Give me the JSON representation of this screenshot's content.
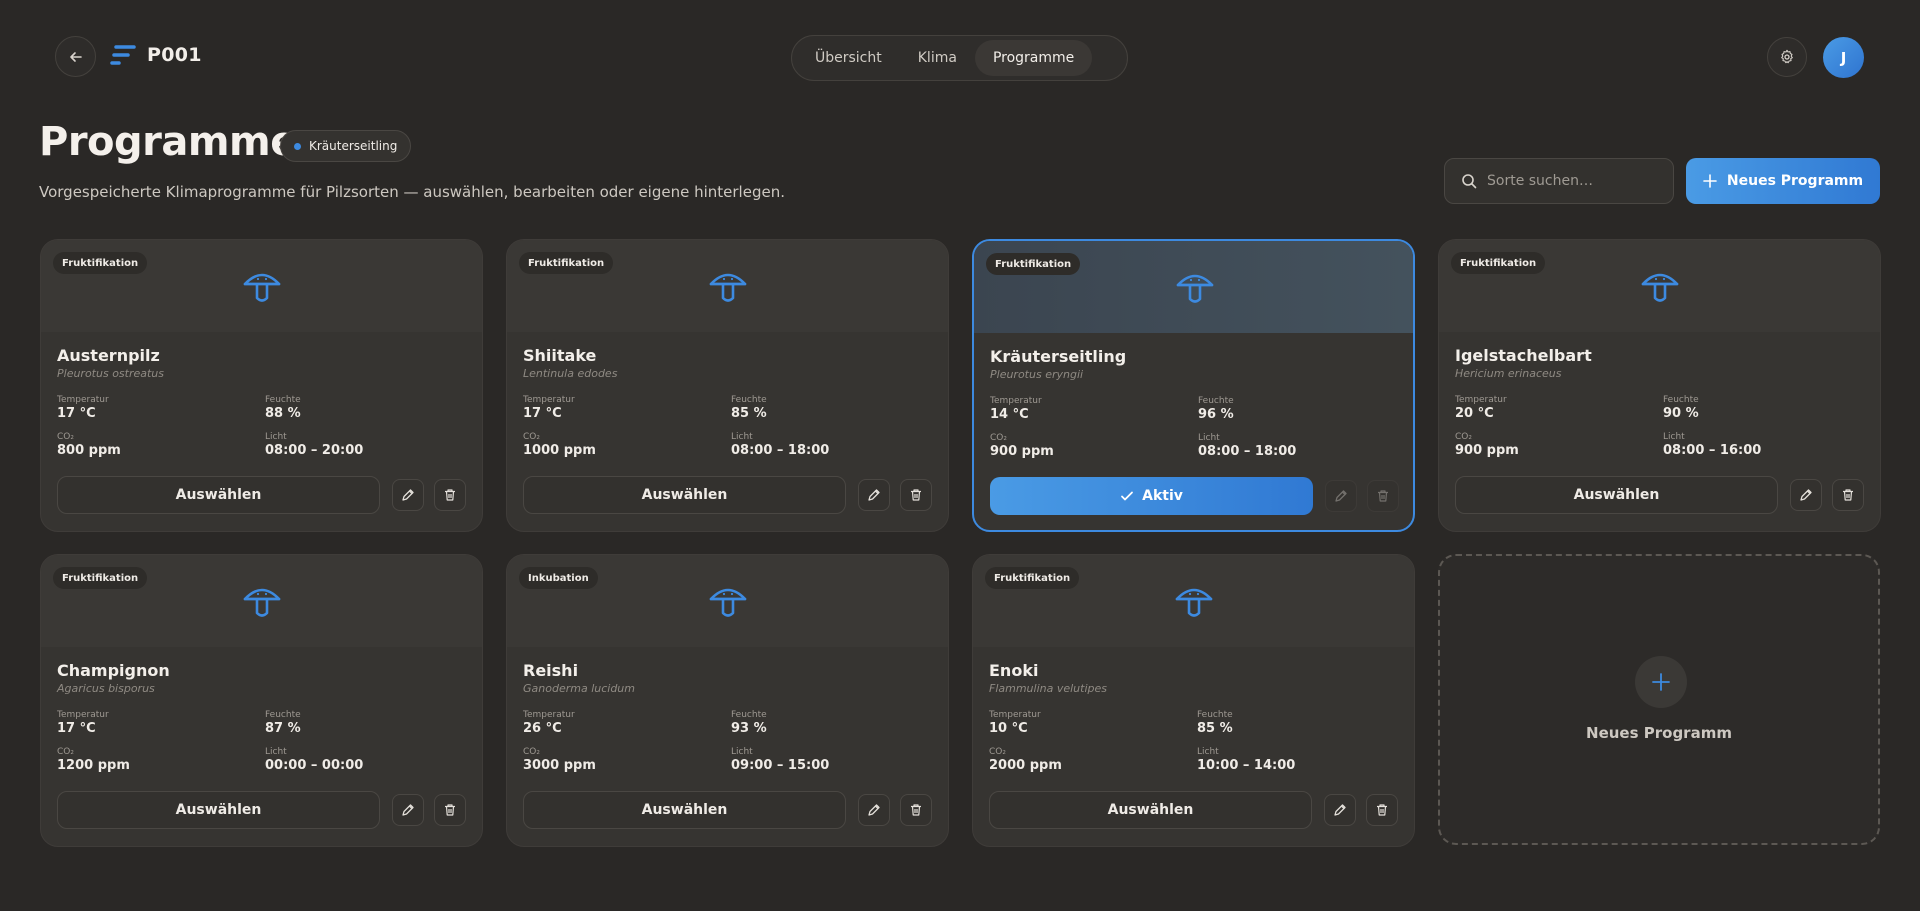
{
  "header": {
    "project": "P001",
    "tabs": [
      {
        "label": "Übersicht",
        "active": false
      },
      {
        "label": "Klima",
        "active": false
      },
      {
        "label": "Programme",
        "active": true
      }
    ],
    "avatar_initial": "J"
  },
  "page": {
    "title": "Programme",
    "active_program_chip": "Kräuterseitling",
    "subtitle": "Vorgespeicherte Klimaprogramme für Pilzsorten — auswählen, bearbeiten oder eigene hinterlegen.",
    "search_placeholder": "Sorte suchen…",
    "new_program_label": "Neues Programm"
  },
  "labels": {
    "temperature": "Temperatur",
    "humidity": "Feuchte",
    "co2": "CO₂",
    "light": "Licht",
    "select": "Auswählen",
    "active": "Aktiv"
  },
  "programs": [
    {
      "phase": "Fruktifikation",
      "name": "Austernpilz",
      "latin": "Pleurotus ostreatus",
      "temp": "17 °C",
      "humidity": "88 %",
      "co2": "800 ppm",
      "light": "08:00 – 20:00",
      "active": false
    },
    {
      "phase": "Fruktifikation",
      "name": "Shiitake",
      "latin": "Lentinula edodes",
      "temp": "17 °C",
      "humidity": "85 %",
      "co2": "1000 ppm",
      "light": "08:00 – 18:00",
      "active": false
    },
    {
      "phase": "Fruktifikation",
      "name": "Kräuterseitling",
      "latin": "Pleurotus eryngii",
      "temp": "14 °C",
      "humidity": "96 %",
      "co2": "900 ppm",
      "light": "08:00 – 18:00",
      "active": true
    },
    {
      "phase": "Fruktifikation",
      "name": "Igelstachelbart",
      "latin": "Hericium erinaceus",
      "temp": "20 °C",
      "humidity": "90 %",
      "co2": "900 ppm",
      "light": "08:00 – 16:00",
      "active": false
    },
    {
      "phase": "Fruktifikation",
      "name": "Champignon",
      "latin": "Agaricus bisporus",
      "temp": "17 °C",
      "humidity": "87 %",
      "co2": "1200 ppm",
      "light": "00:00 – 00:00",
      "active": false
    },
    {
      "phase": "Inkubation",
      "name": "Reishi",
      "latin": "Ganoderma lucidum",
      "temp": "26 °C",
      "humidity": "93 %",
      "co2": "3000 ppm",
      "light": "09:00 – 15:00",
      "active": false
    },
    {
      "phase": "Fruktifikation",
      "name": "Enoki",
      "latin": "Flammulina velutipes",
      "temp": "10 °C",
      "humidity": "85 %",
      "co2": "2000 ppm",
      "light": "10:00 – 14:00",
      "active": false
    }
  ],
  "add_card_label": "Neues Programm",
  "colors": {
    "accent": "#3d8ae0",
    "background": "#2a2826",
    "card": "#363431"
  }
}
